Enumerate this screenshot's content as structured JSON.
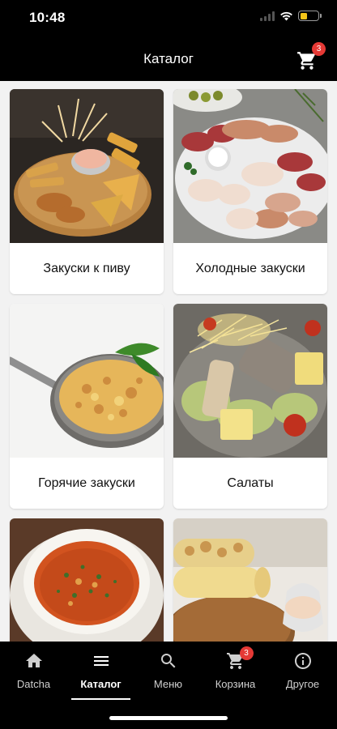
{
  "status": {
    "time": "10:48",
    "battery_color": "#f5c518"
  },
  "header": {
    "title": "Каталог",
    "cart_badge": "3",
    "cart_icon": "cart-icon"
  },
  "categories": [
    {
      "label": "Закуски к пиву",
      "image": "beer-snacks-photo"
    },
    {
      "label": "Холодные закуски",
      "image": "cold-cuts-photo"
    },
    {
      "label": "Горячие закуски",
      "image": "hot-appetizer-photo"
    },
    {
      "label": "Салаты",
      "image": "salad-photo"
    },
    {
      "label": "",
      "image": "soup-photo"
    },
    {
      "label": "",
      "image": "shawarma-photo"
    }
  ],
  "tabs": [
    {
      "label": "Datcha",
      "icon": "home-icon"
    },
    {
      "label": "Каталог",
      "icon": "menu-lines-icon",
      "active": true
    },
    {
      "label": "Меню",
      "icon": "search-icon"
    },
    {
      "label": "Корзина",
      "icon": "cart-icon",
      "badge": "3"
    },
    {
      "label": "Другое",
      "icon": "info-icon"
    }
  ],
  "colors": {
    "accent_badge": "#e53935",
    "background": "#f2f2f2",
    "bars": "#000000"
  }
}
